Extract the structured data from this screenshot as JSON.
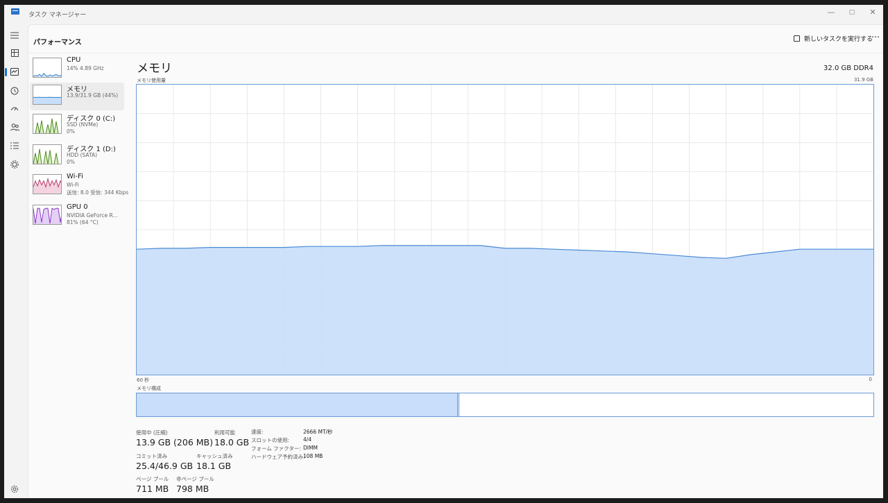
{
  "window": {
    "title": "タスク マネージャー",
    "controls": {
      "minimize": "—",
      "maximize": "▢",
      "close": "✕"
    }
  },
  "nav": {
    "icons": [
      "menu-icon",
      "processes-icon",
      "performance-icon",
      "app-history-icon",
      "startup-icon",
      "users-icon",
      "details-icon",
      "services-icon"
    ],
    "settings_icon": "gear-icon"
  },
  "header": {
    "title": "パフォーマンス",
    "run_task_label": "新しいタスクを実行する",
    "more_label": "···"
  },
  "devices": [
    {
      "name": "CPU",
      "line1": "14%  4.89 GHz",
      "line2": "",
      "color": "#2a7fc9",
      "fill": "#dbe9f7"
    },
    {
      "name": "メモリ",
      "line1": "13.9/31.9 GB (44%)",
      "line2": "",
      "color": "#2a7fc9",
      "fill": "#c9defa"
    },
    {
      "name": "ディスク 0 (C:)",
      "line1": "SSD (NVMe)",
      "line2": "0%",
      "color": "#4d8a1c",
      "fill": "#d9ecc4"
    },
    {
      "name": "ディスク 1 (D:)",
      "line1": "HDD (SATA)",
      "line2": "0%",
      "color": "#4d8a1c",
      "fill": "#d9ecc4"
    },
    {
      "name": "Wi-Fi",
      "line1": "Wi-Fi",
      "line2": "送信: 8.0  受信: 344 Kbps",
      "color": "#b83f6e",
      "fill": "#f3d3df"
    },
    {
      "name": "GPU 0",
      "line1": "NVIDIA GeForce R...",
      "line2": "81%  (64 °C)",
      "color": "#8a38c8",
      "fill": "#e4d0f5"
    }
  ],
  "memory": {
    "title": "メモリ",
    "spec": "32.0 GB DDR4",
    "usage_label": "メモリ使用量",
    "usage_max": "31.9 GB",
    "axis_left": "60 秒",
    "axis_right": "0",
    "composition_label": "メモリ構成",
    "composition_used_fraction": 0.436,
    "composition_modified_fraction": 0.003,
    "stats": {
      "in_use_label": "使用中 (圧縮)",
      "in_use_value": "13.9 GB (206 MB)",
      "available_label": "利用可能",
      "available_value": "18.0 GB",
      "committed_label": "コミット済み",
      "committed_value": "25.4/46.9 GB",
      "cached_label": "キャッシュ済み",
      "cached_value": "18.1 GB",
      "paged_label": "ページ プール",
      "paged_value": "711 MB",
      "nonpaged_label": "非ページ プール",
      "nonpaged_value": "798 MB"
    },
    "details": [
      {
        "key": "速度:",
        "value": "2666 MT/秒"
      },
      {
        "key": "スロットの使用:",
        "value": "4/4"
      },
      {
        "key": "フォーム ファクター:",
        "value": "DIMM"
      },
      {
        "key": "ハードウェア予約済み:",
        "value": "108 MB"
      }
    ],
    "colors": {
      "line": "#4a8ad6",
      "fill": "#c9defa",
      "grid": "#e8e8e8"
    }
  },
  "chart_data": {
    "type": "area",
    "ylabel": "メモリ使用量",
    "ylim": [
      0,
      31.9
    ],
    "xlim": [
      60,
      0
    ],
    "x": [
      60,
      58,
      56,
      54,
      52,
      50,
      48,
      46,
      44,
      42,
      40,
      38,
      36,
      34,
      32,
      30,
      28,
      26,
      24,
      22,
      20,
      18,
      16,
      14,
      12,
      10,
      8,
      6,
      4,
      2,
      0
    ],
    "series": [
      {
        "values": [
          13.8,
          13.9,
          13.9,
          14.0,
          14.0,
          14.0,
          14.0,
          14.1,
          14.1,
          14.1,
          14.2,
          14.2,
          14.2,
          14.2,
          14.2,
          13.9,
          13.9,
          13.8,
          13.7,
          13.6,
          13.5,
          13.3,
          13.1,
          12.9,
          12.8,
          13.2,
          13.5,
          13.8,
          13.8,
          13.8,
          13.8
        ]
      }
    ]
  }
}
